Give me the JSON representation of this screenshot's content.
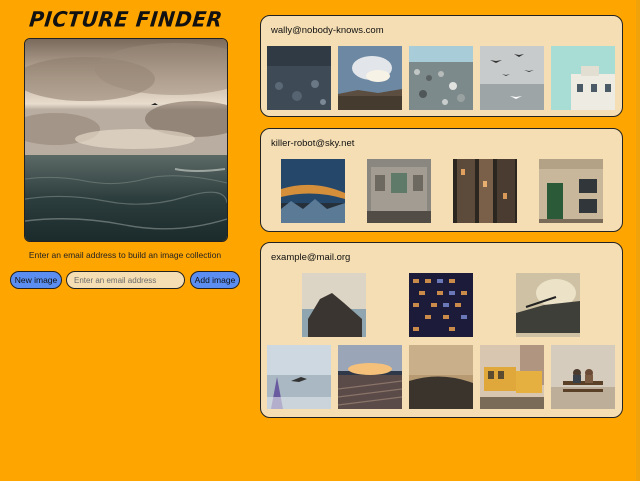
{
  "app": {
    "title": "PICTURE FINDER",
    "instruction": "Enter an email address to build an image collection"
  },
  "controls": {
    "new_image_label": "New image",
    "email_placeholder": "Enter an email address",
    "email_value": "",
    "add_image_label": "Add image"
  },
  "collections": [
    {
      "email": "wally@nobody-knows.com",
      "image_count": 5
    },
    {
      "email": "killer-robot@sky.net",
      "image_count": 4
    },
    {
      "email": "example@mail.org",
      "image_count": 8
    }
  ],
  "colors": {
    "background": "#FFA500",
    "panel": "#F5DEB3",
    "button": "#5B8EF0",
    "border": "#222222"
  }
}
